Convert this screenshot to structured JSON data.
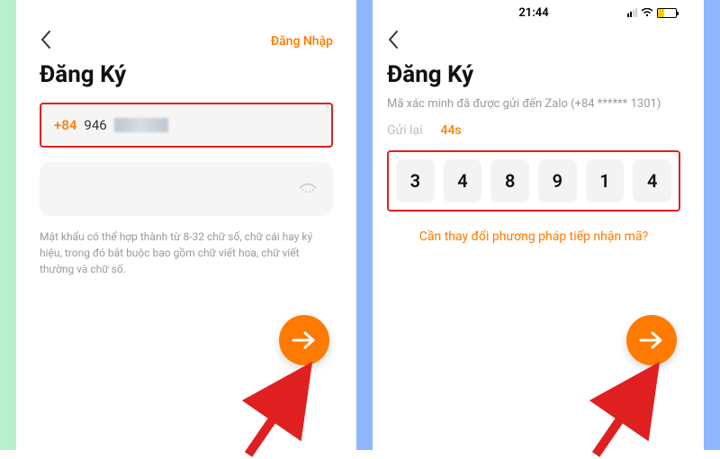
{
  "left": {
    "login_link": "Đăng Nhập",
    "title": "Đăng Ký",
    "country_code": "+84",
    "phone_visible": "946",
    "password_hint": "Mật khẩu có thể hợp thành từ 8-32 chữ số, chữ cái hay ký hiệu, trong đó bắt buộc bao gồm chữ viết hoa, chữ viết thường và chữ số."
  },
  "right": {
    "status_time": "21:44",
    "title": "Đăng Ký",
    "sent_msg": "Mã xác minh đã được gửi đến Zalo (+84 ****** 1301)",
    "resend_label": "Gửi lại",
    "countdown": "44s",
    "otp": [
      "3",
      "4",
      "8",
      "9",
      "1",
      "4"
    ],
    "alt_method": "Cần thay đổi phương pháp tiếp nhận mã?"
  }
}
